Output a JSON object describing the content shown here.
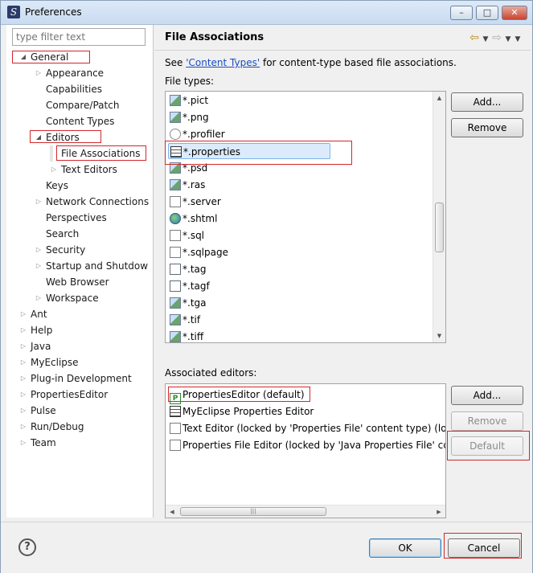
{
  "window": {
    "title": "Preferences",
    "icon_letter": "S"
  },
  "filter": {
    "placeholder": "type filter text"
  },
  "tree": [
    {
      "label": "General",
      "twisty": "expanded"
    },
    {
      "label": "Appearance",
      "twisty": "collapsed"
    },
    {
      "label": "Capabilities",
      "twisty": "none"
    },
    {
      "label": "Compare/Patch",
      "twisty": "none"
    },
    {
      "label": "Content Types",
      "twisty": "none"
    },
    {
      "label": "Editors",
      "twisty": "expanded"
    },
    {
      "label": "File Associations",
      "twisty": "none"
    },
    {
      "label": "Text Editors",
      "twisty": "collapsed"
    },
    {
      "label": "Keys",
      "twisty": "none"
    },
    {
      "label": "Network Connections",
      "twisty": "collapsed"
    },
    {
      "label": "Perspectives",
      "twisty": "none"
    },
    {
      "label": "Search",
      "twisty": "none"
    },
    {
      "label": "Security",
      "twisty": "collapsed"
    },
    {
      "label": "Startup and Shutdow",
      "twisty": "collapsed"
    },
    {
      "label": "Web Browser",
      "twisty": "none"
    },
    {
      "label": "Workspace",
      "twisty": "collapsed"
    },
    {
      "label": "Ant",
      "twisty": "collapsed"
    },
    {
      "label": "Help",
      "twisty": "collapsed"
    },
    {
      "label": "Java",
      "twisty": "collapsed"
    },
    {
      "label": "MyEclipse",
      "twisty": "collapsed"
    },
    {
      "label": "Plug-in Development",
      "twisty": "collapsed"
    },
    {
      "label": "PropertiesEditor",
      "twisty": "collapsed"
    },
    {
      "label": "Pulse",
      "twisty": "collapsed"
    },
    {
      "label": "Run/Debug",
      "twisty": "collapsed"
    },
    {
      "label": "Team",
      "twisty": "collapsed"
    }
  ],
  "page": {
    "title": "File Associations",
    "see_prefix": "See ",
    "see_link": "'Content Types'",
    "see_suffix": " for content-type based file associations.",
    "file_types_label": "File types:",
    "assoc_label": "Associated editors:"
  },
  "file_types": [
    {
      "name": "*.pict",
      "icon": "img"
    },
    {
      "name": "*.png",
      "icon": "img"
    },
    {
      "name": "*.profiler",
      "icon": "gear"
    },
    {
      "name": "*.properties",
      "icon": "tbl",
      "selected": true
    },
    {
      "name": "*.psd",
      "icon": "img"
    },
    {
      "name": "*.ras",
      "icon": "img"
    },
    {
      "name": "*.server",
      "icon": "doc"
    },
    {
      "name": "*.shtml",
      "icon": "globe"
    },
    {
      "name": "*.sql",
      "icon": "doc"
    },
    {
      "name": "*.sqlpage",
      "icon": "doc"
    },
    {
      "name": "*.tag",
      "icon": "jf"
    },
    {
      "name": "*.tagf",
      "icon": "jf"
    },
    {
      "name": "*.tga",
      "icon": "img"
    },
    {
      "name": "*.tif",
      "icon": "img"
    },
    {
      "name": "*.tiff",
      "icon": "img"
    }
  ],
  "editors": [
    {
      "name": "PropertiesEditor (default)",
      "icon": "P"
    },
    {
      "name": "MyEclipse Properties Editor",
      "icon": "tbl"
    },
    {
      "name": "Text Editor (locked by 'Properties File' content type) (loc",
      "icon": "doc"
    },
    {
      "name": "Properties File Editor (locked by 'Java Properties File' cc",
      "icon": "doc"
    }
  ],
  "buttons": {
    "add1": "Add...",
    "remove1": "Remove",
    "add2": "Add...",
    "remove2": "Remove",
    "default": "Default",
    "ok": "OK",
    "cancel": "Cancel",
    "help": "?"
  },
  "colors": {
    "highlight": "#d0282c",
    "link": "#1a4dc4"
  }
}
